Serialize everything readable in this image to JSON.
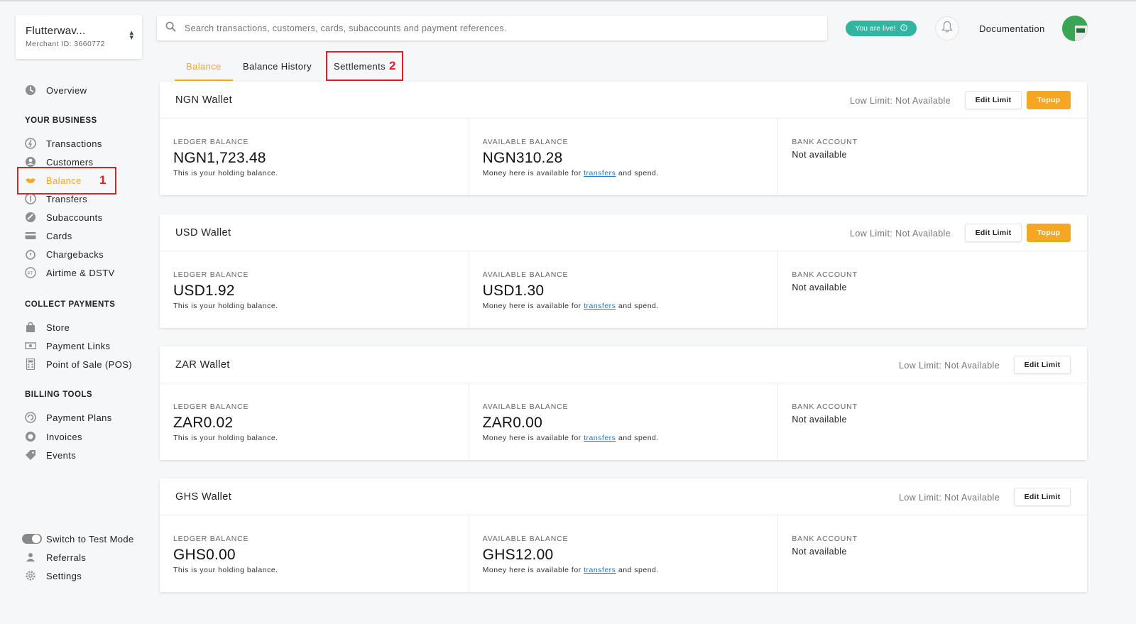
{
  "merchant": {
    "name": "Flutterwav...",
    "id_text": "Merchant ID: 3660772"
  },
  "search": {
    "placeholder": "Search transactions, customers, cards, subaccounts and payment references."
  },
  "header": {
    "live_label": "You are live!",
    "docs_label": "Documentation"
  },
  "sidebar": {
    "overview": "Overview",
    "section_business": "YOUR BUSINESS",
    "business_items": [
      "Transactions",
      "Customers",
      "Balance",
      "Transfers",
      "Subaccounts",
      "Cards",
      "Chargebacks",
      "Airtime & DSTV"
    ],
    "section_collect": "COLLECT PAYMENTS",
    "collect_items": [
      "Store",
      "Payment Links",
      "Point of Sale (POS)"
    ],
    "section_billing": "BILLING TOOLS",
    "billing_items": [
      "Payment Plans",
      "Invoices",
      "Events"
    ],
    "footer_items": [
      "Switch to Test Mode",
      "Referrals",
      "Settings"
    ]
  },
  "annotations": {
    "one": "1",
    "two": "2"
  },
  "tabs": [
    "Balance",
    "Balance History",
    "Settlements"
  ],
  "colors": {
    "accent": "#f5a623",
    "live": "#2fb5a0",
    "annotation": "#e02020",
    "link": "#1f78c1"
  },
  "labels": {
    "ledger": "LEDGER BALANCE",
    "available": "AVAILABLE BALANCE",
    "bank": "BANK ACCOUNT",
    "ledger_note": "This is your holding balance.",
    "available_note_pre": "Money here is available for ",
    "available_note_link": "transfers",
    "available_note_post": " and spend.",
    "not_available": "Not available",
    "low_limit": "Low Limit: Not Available",
    "edit_limit": "Edit Limit",
    "topup": "Topup"
  },
  "wallets": [
    {
      "title": "NGN Wallet",
      "ledger": "NGN1,723.48",
      "available": "NGN310.28"
    },
    {
      "title": "USD Wallet",
      "ledger": "USD1.92",
      "available": "USD1.30"
    },
    {
      "title": "ZAR Wallet",
      "ledger": "ZAR0.02",
      "available": "ZAR0.00"
    },
    {
      "title": "GHS Wallet",
      "ledger": "GHS0.00",
      "available": "GHS12.00"
    }
  ]
}
